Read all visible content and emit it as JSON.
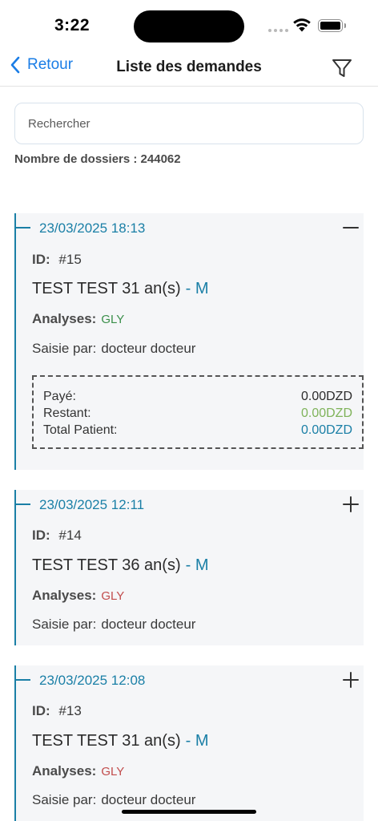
{
  "status_bar": {
    "time": "3:22"
  },
  "nav": {
    "back_label": "Retour",
    "title": "Liste des demandes"
  },
  "search": {
    "placeholder": "Rechercher",
    "value": ""
  },
  "count_label": "Nombre de dossiers : 244062",
  "labels": {
    "id": "ID:",
    "analyses": "Analyses:",
    "saisie": "Saisie par:",
    "paid": "Payé:",
    "remaining": "Restant:",
    "total": "Total Patient:"
  },
  "cards": [
    {
      "datetime": "23/03/2025 18:13",
      "expanded": true,
      "id": "#15",
      "patient": "TEST TEST 31 an(s)",
      "sex": "- M",
      "analyses": "GLY",
      "saisie": "docteur docteur",
      "paid": "0.00DZD",
      "remaining": "0.00DZD",
      "total": "0.00DZD"
    },
    {
      "datetime": "23/03/2025 12:11",
      "expanded": false,
      "id": "#14",
      "patient": "TEST TEST 36 an(s)",
      "sex": "- M",
      "analyses": "GLY",
      "saisie": "docteur docteur"
    },
    {
      "datetime": "23/03/2025 12:08",
      "expanded": false,
      "id": "#13",
      "patient": "TEST TEST 31 an(s)",
      "sex": "- M",
      "analyses": "GLY",
      "saisie": "docteur docteur"
    }
  ],
  "colors": {
    "accent": "#1a7de6",
    "card_accent": "#1a7fa6",
    "analysis_ok": "#3a8f4a",
    "analysis_pending": "#c14c4c",
    "remaining": "#7fb35a"
  },
  "icons": [
    "chevron-left-icon",
    "filter-icon",
    "collapse-icon",
    "expand-icon",
    "wifi-icon",
    "battery-icon"
  ]
}
